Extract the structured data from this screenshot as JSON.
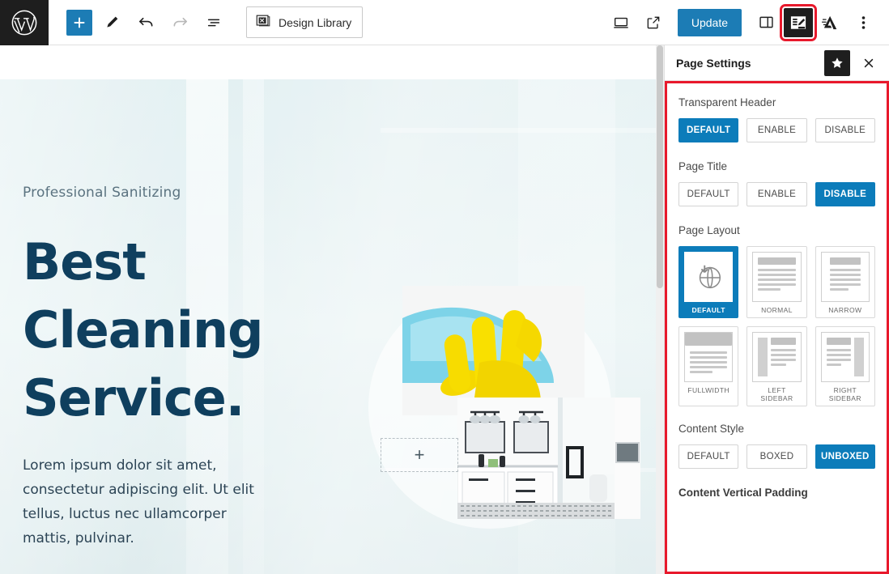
{
  "toolbar": {
    "logo_icon": "wordpress-logo-icon",
    "add_label": "+",
    "design_library_label": "Design Library",
    "update_label": "Update",
    "icons": {
      "add": "add-block-icon",
      "edit": "edit-pencil-icon",
      "undo": "undo-icon",
      "redo": "redo-icon",
      "list_view": "list-view-icon",
      "design_library": "design-library-icon",
      "preview": "desktop-preview-icon",
      "view_external": "view-external-link-icon",
      "sidebar": "settings-sidebar-icon",
      "page_settings": "page-settings-icon",
      "astra_logo": "astra-logo-icon",
      "more": "more-options-icon"
    }
  },
  "canvas": {
    "hero": {
      "eyebrow": "Professional Sanitizing",
      "headline_lines": [
        "Best",
        "Cleaning",
        "Service."
      ],
      "paragraph": "Lorem ipsum dolor sit amet, consectetur adipiscing elit. Ut elit tellus, luctus nec ullamcorper mattis, pulvinar.",
      "placeholder_plus": "+"
    }
  },
  "panel": {
    "title": "Page Settings",
    "star_icon": "star-icon",
    "close_icon": "close-icon",
    "sections": {
      "transparent_header": {
        "label": "Transparent Header",
        "options": [
          "DEFAULT",
          "ENABLE",
          "DISABLE"
        ],
        "selected": "DEFAULT"
      },
      "page_title": {
        "label": "Page Title",
        "options": [
          "DEFAULT",
          "ENABLE",
          "DISABLE"
        ],
        "selected": "DISABLE"
      },
      "page_layout": {
        "label": "Page Layout",
        "options": [
          {
            "caption": "DEFAULT",
            "thumb": "globe",
            "selected": true
          },
          {
            "caption": "NORMAL",
            "thumb": "normal",
            "selected": false
          },
          {
            "caption": "NARROW",
            "thumb": "narrow",
            "selected": false
          },
          {
            "caption": "FULLWIDTH",
            "thumb": "fullwidth",
            "selected": false
          },
          {
            "caption": "LEFT SIDEBAR",
            "thumb": "left-sidebar",
            "selected": false
          },
          {
            "caption": "RIGHT SIDEBAR",
            "thumb": "right-sidebar",
            "selected": false
          }
        ]
      },
      "content_style": {
        "label": "Content Style",
        "options": [
          "DEFAULT",
          "BOXED",
          "UNBOXED"
        ],
        "selected": "UNBOXED"
      },
      "content_vertical_padding": {
        "label": "Content Vertical Padding"
      }
    }
  },
  "colors": {
    "accent_blue": "#0c7cba",
    "toolbar_blue": "#1c7cb5",
    "highlight_red": "#e8192c",
    "dark": "#1e1e1e",
    "headline": "#0f3f5e"
  }
}
